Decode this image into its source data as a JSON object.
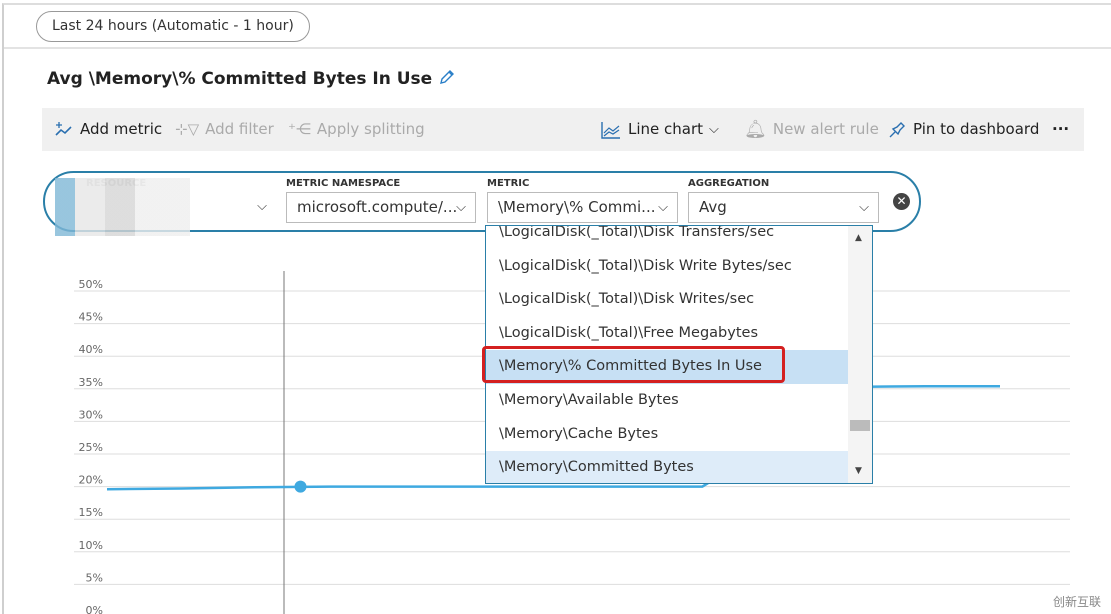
{
  "time_range": "Last 24 hours (Automatic - 1 hour)",
  "chart_title": "Avg \\Memory\\% Committed Bytes In Use",
  "toolbar": {
    "add_metric": "Add metric",
    "add_filter": "Add filter",
    "apply_splitting": "Apply splitting",
    "chart_type": "Line chart",
    "new_alert_rule": "New alert rule",
    "pin": "Pin to dashboard",
    "more": "···"
  },
  "selector": {
    "resource_label": "RESOURCE",
    "namespace_label": "METRIC NAMESPACE",
    "namespace_value": "microsoft.compute/...",
    "metric_label": "METRIC",
    "metric_value": "\\Memory\\% Commi...",
    "aggregation_label": "AGGREGATION",
    "aggregation_value": "Avg"
  },
  "metric_options": [
    "\\LogicalDisk(_Total)\\Disk Transfers/sec",
    "\\LogicalDisk(_Total)\\Disk Write Bytes/sec",
    "\\LogicalDisk(_Total)\\Disk Writes/sec",
    "\\LogicalDisk(_Total)\\Free Megabytes",
    "\\Memory\\% Committed Bytes In Use",
    "\\Memory\\Available Bytes",
    "\\Memory\\Cache Bytes",
    "\\Memory\\Committed Bytes"
  ],
  "selected_option_index": 4,
  "watermark": "创新互联",
  "colors": {
    "accent": "#2a7fa8",
    "series": "#3fa9e0",
    "highlight": "#d42020"
  },
  "chart_data": {
    "type": "line",
    "ylim": [
      0,
      50
    ],
    "yticks": [
      "0%",
      "5%",
      "10%",
      "15%",
      "20%",
      "25%",
      "30%",
      "35%",
      "40%",
      "45%",
      "50%"
    ],
    "grid": true,
    "series": [
      {
        "values": [
          19.6,
          19.7,
          19.9,
          20,
          20,
          20,
          20,
          20,
          20,
          27,
          35.3,
          35.4,
          35.4
        ]
      }
    ],
    "hover_point": {
      "index": 2.6,
      "value": 20
    }
  }
}
